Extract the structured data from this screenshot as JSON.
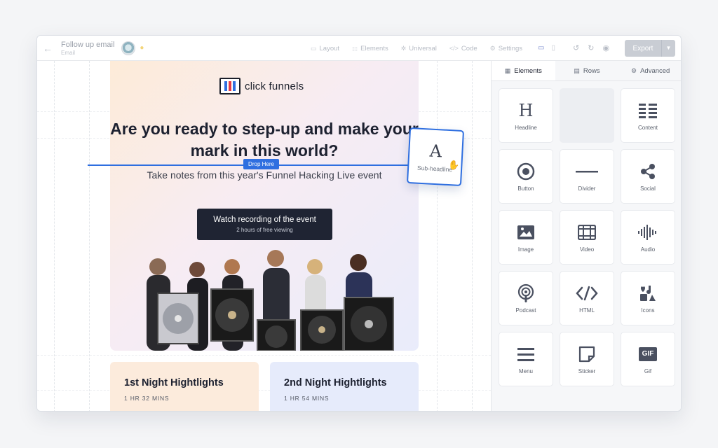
{
  "app": {
    "doc_title": "Follow up email",
    "doc_subtitle": "Email",
    "menu": [
      {
        "label": "Layout",
        "icon": "layout-icon"
      },
      {
        "label": "Elements",
        "icon": "elements-icon"
      },
      {
        "label": "Universal",
        "icon": "universal-icon"
      },
      {
        "label": "Code",
        "icon": "code-icon"
      },
      {
        "label": "Settings",
        "icon": "settings-icon"
      }
    ],
    "export_label": "Export"
  },
  "email": {
    "logo_text": "click funnels",
    "headline": "Are you ready to step-up and make your mark in this world?",
    "subheadline": "Take notes from this year's Funnel Hacking Live event",
    "cta_title": "Watch recording of the event",
    "cta_sub": "2 hours of free viewing",
    "drop_tag": "Drop Here",
    "dragging_label": "Sub-headline",
    "cards": [
      {
        "title": "1st Night Hightlights",
        "sub": "1 HR 32 MINS"
      },
      {
        "title": "2nd Night Hightlights",
        "sub": "1 HR 54 MINS"
      }
    ]
  },
  "panel": {
    "tabs": [
      {
        "label": "Elements",
        "icon": "grid-icon",
        "active": true
      },
      {
        "label": "Rows",
        "icon": "rows-icon",
        "active": false
      },
      {
        "label": "Advanced",
        "icon": "gear-icon",
        "active": false
      }
    ],
    "tiles": [
      {
        "label": "Headline",
        "icon": "headline-icon"
      },
      {
        "label": "",
        "icon": ""
      },
      {
        "label": "Content",
        "icon": "content-icon"
      },
      {
        "label": "Button",
        "icon": "button-icon"
      },
      {
        "label": "Divider",
        "icon": "divider-icon"
      },
      {
        "label": "Social",
        "icon": "social-icon"
      },
      {
        "label": "Image",
        "icon": "image-icon"
      },
      {
        "label": "Video",
        "icon": "video-icon"
      },
      {
        "label": "Audio",
        "icon": "audio-icon"
      },
      {
        "label": "Podcast",
        "icon": "podcast-icon"
      },
      {
        "label": "HTML",
        "icon": "html-icon"
      },
      {
        "label": "Icons",
        "icon": "icons-icon"
      },
      {
        "label": "Menu",
        "icon": "menu-icon"
      },
      {
        "label": "Sticker",
        "icon": "sticker-icon"
      },
      {
        "label": "Gif",
        "icon": "gif-icon"
      }
    ]
  },
  "colors": {
    "accent": "#2f6fe0",
    "cta_bg": "#1f2433",
    "card1_bg": "#fcebdc",
    "card2_bg": "#e6ebfb"
  }
}
